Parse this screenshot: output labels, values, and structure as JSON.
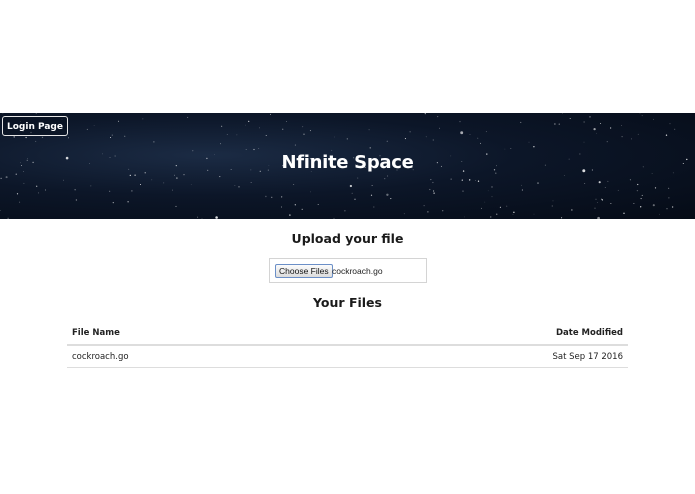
{
  "header": {
    "login_label": "Login Page",
    "title": "Nfinite Space"
  },
  "upload": {
    "heading": "Upload your file",
    "choose_label": "Choose Files",
    "chosen_file": "cockroach.go"
  },
  "files": {
    "heading": "Your Files",
    "columns": [
      "File Name",
      "Date Modified"
    ],
    "rows": [
      {
        "name": "cockroach.go",
        "modified": "Sat Sep 17 2016"
      }
    ]
  },
  "colors": {
    "hero_background": "#0c1628",
    "title_text": "#ffffff"
  }
}
